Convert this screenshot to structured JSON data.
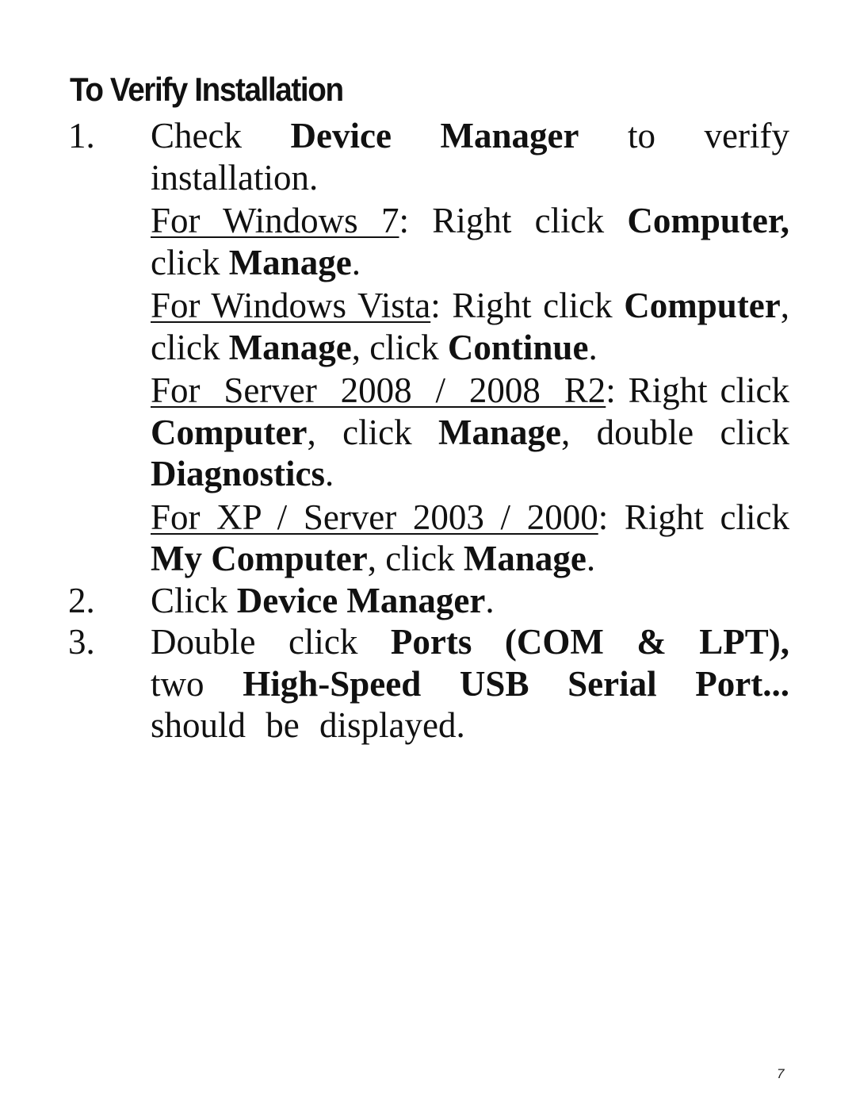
{
  "heading": "To Verify Installation",
  "steps": [
    {
      "number": "1.",
      "intro": {
        "t1": "Check ",
        "b1": "Device Manager",
        "t2": " to verify installation."
      },
      "sub_instructions": [
        {
          "label": "For Windows 7",
          "t1": ": Right click ",
          "b1": "Computer,",
          "t2": " click ",
          "b2": "Manage",
          "t3": "."
        },
        {
          "label": "For Windows Vista",
          "t1": ": Right click ",
          "b1": "Computer",
          "t2": ", click ",
          "b2": "Manage",
          "t3": ", click ",
          "b3": "Continue",
          "t4": "."
        },
        {
          "label": "For Server 2008 / 2008 R2",
          "t1": ": Right click ",
          "b1": "Computer",
          "t2": ", click ",
          "b2": "Manage",
          "t3": ", double click ",
          "b3": "Diagnostics",
          "t4": "."
        },
        {
          "label": "For XP / Server 2003 / 2000",
          "t1": ": Right click ",
          "b1": "My Computer",
          "t2": ", click ",
          "b2": "Manage",
          "t3": "."
        }
      ]
    },
    {
      "number": "2.",
      "t1": "Click ",
      "b1": "Device Manager",
      "t2": "."
    },
    {
      "number": "3.",
      "t1": "Double click ",
      "b1": "Ports (COM & LPT),",
      "t2": " two ",
      "b2": "High-Speed USB Serial Port...",
      "t3": " should be displayed."
    }
  ],
  "page_number": "7"
}
